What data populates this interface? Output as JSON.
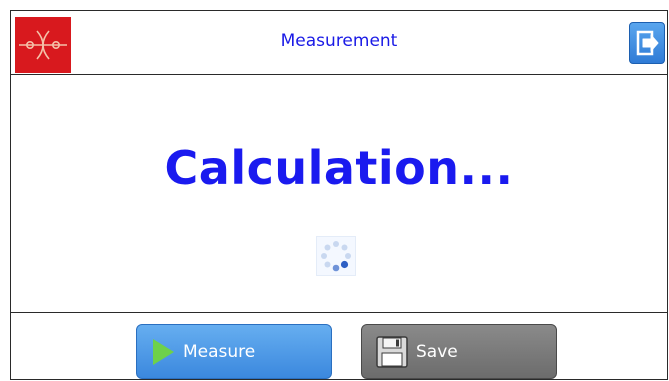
{
  "header": {
    "title": "Measurement",
    "logo_icon": "instrument-logo-icon",
    "exit_icon": "exit-icon"
  },
  "main": {
    "status_text": "Calculation...",
    "spinner_icon": "loading-spinner-icon"
  },
  "footer": {
    "measure_label": "Measure",
    "measure_icon": "play-icon",
    "save_label": "Save",
    "save_icon": "floppy-disk-icon"
  },
  "colors": {
    "title_blue": "#1a1ae6",
    "logo_red": "#d8191e",
    "button_blue": "#3b88de",
    "button_gray": "#6c6c6c",
    "play_green": "#6ed14a"
  }
}
